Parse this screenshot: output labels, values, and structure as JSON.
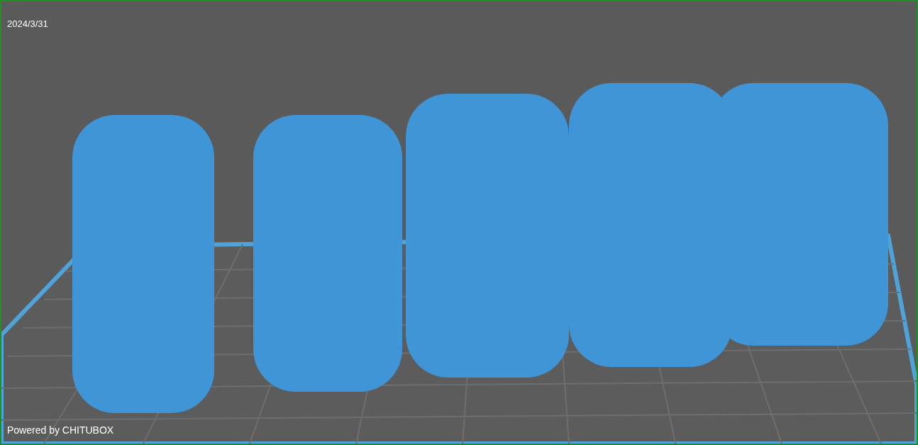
{
  "viewport": {
    "date": "2024/3/31",
    "footer": "Powered by CHITUBOX"
  }
}
